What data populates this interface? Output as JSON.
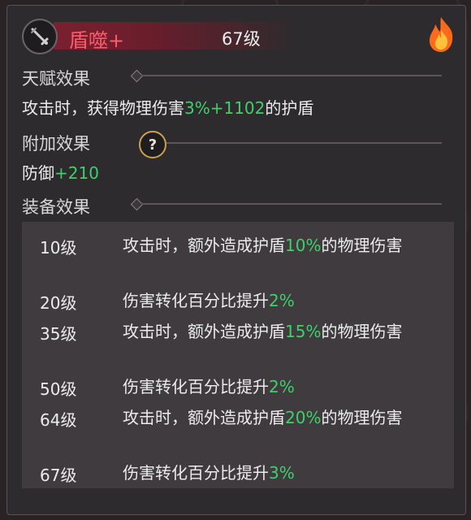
{
  "skill": {
    "name": "盾噬+",
    "level": "67级",
    "icon": "sword-shield-icon",
    "badge_icon": "fire-icon"
  },
  "talent": {
    "title": "天赋效果",
    "text_before": "攻击时，获得物理伤害",
    "text_value": "3%+1102",
    "text_after": "的护盾"
  },
  "additional": {
    "title": "附加效果",
    "help_icon": "question-mark-icon",
    "stat_name": "防御",
    "stat_value": "+210"
  },
  "equipment": {
    "title": "装备效果",
    "rows": [
      {
        "level": "10级",
        "before": "攻击时，额外造成护盾",
        "value": "10%",
        "after": "的物理伤害"
      },
      {
        "level": "20级",
        "before": "伤害转化百分比提升",
        "value": "2%",
        "after": ""
      },
      {
        "level": "35级",
        "before": "攻击时，额外造成护盾",
        "value": "15%",
        "after": "的物理伤害"
      },
      {
        "level": "50级",
        "before": "伤害转化百分比提升",
        "value": "2%",
        "after": ""
      },
      {
        "level": "64级",
        "before": "攻击时，额外造成护盾",
        "value": "20%",
        "after": "的物理伤害"
      },
      {
        "level": "67级",
        "before": "伤害转化百分比提升",
        "value": "3%",
        "after": ""
      }
    ]
  },
  "colors": {
    "highlight_green": "#3fd06a",
    "name_red": "#ff5a6a",
    "name_bar": "#7a2030"
  }
}
